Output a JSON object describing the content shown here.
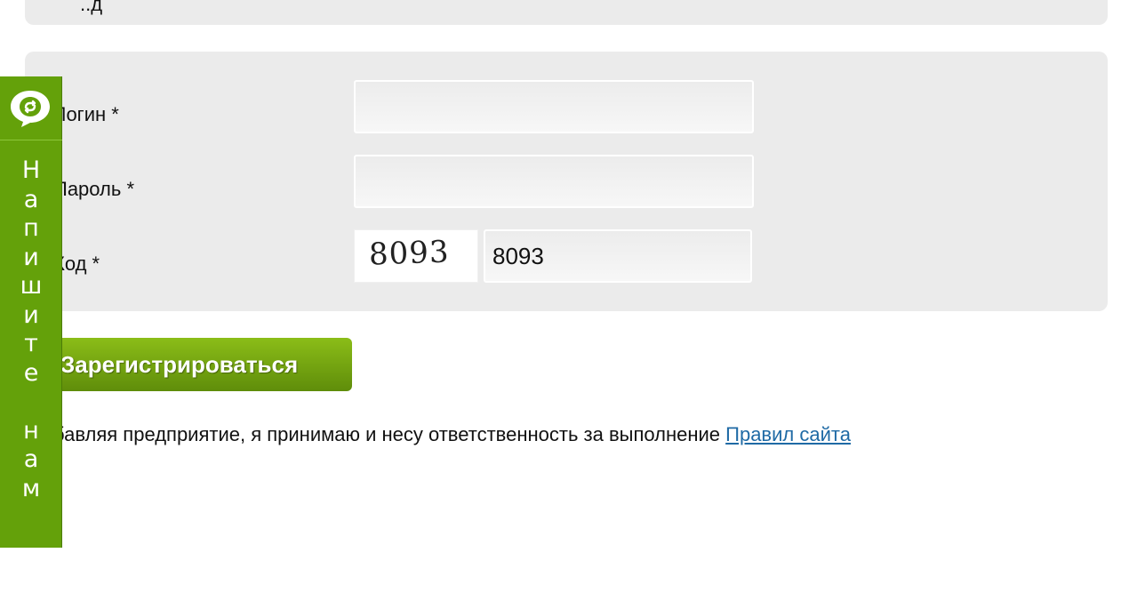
{
  "top_panel": {
    "cut_text": "..д"
  },
  "form": {
    "login": {
      "label": "Логин *",
      "value": "",
      "placeholder": ""
    },
    "password": {
      "label": "Пароль *",
      "value": "",
      "placeholder": ""
    },
    "code": {
      "label": "Код *",
      "captcha_text": "8093",
      "value": "8093"
    }
  },
  "register_button": {
    "label": "Зарегистрироваться"
  },
  "terms": {
    "text": "бавляя предприятие, я принимаю и несу ответственность за выполнение",
    "link_label": "Правил сайта"
  },
  "side_widget": {
    "icon": "chat-bubble-icon",
    "text": "Напишите нам",
    "color": "#64a10a"
  },
  "colors": {
    "panel_bg": "#ebebeb",
    "button_green": "#6b9a0e",
    "link_blue": "#1f6aa5"
  }
}
